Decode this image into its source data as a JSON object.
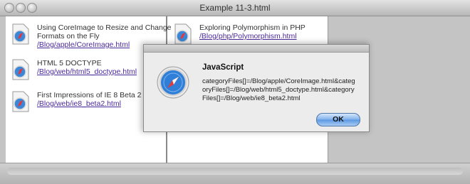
{
  "window": {
    "title": "Example 11-3.html"
  },
  "files": [
    {
      "title": "Using CoreImage to Resize and Change",
      "title_line2": "Formats on the Fly",
      "link": "/Blog/apple/CoreImage.html"
    },
    {
      "title": "Exploring Polymorphism in PHP",
      "link": "/Blog/php/Polymorphism.html"
    },
    {
      "title": "HTML 5 DOCTYPE",
      "link": "/Blog/web/html5_doctype.html"
    },
    {
      "title": "First Impressions of IE 8 Beta 2",
      "link": "/Blog/web/ie8_beta2.html"
    }
  ],
  "dialog": {
    "title": "JavaScript",
    "message": "categoryFiles[]=/Blog/apple/CoreImage.html&categoryFiles[]=/Blog/web/html5_doctype.html&categoryFiles[]=/Blog/web/ie8_beta2.html",
    "ok_label": "OK"
  },
  "colors": {
    "link": "#4b2a9a",
    "accent_button": "#5a98e2"
  }
}
